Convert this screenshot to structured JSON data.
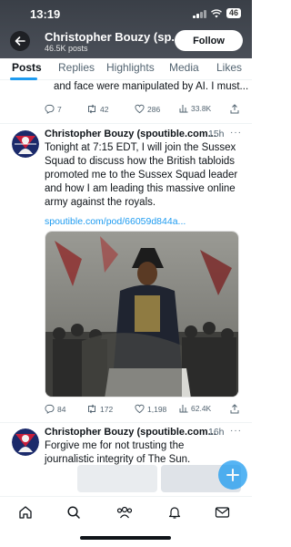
{
  "status_bar": {
    "time": "13:19",
    "battery": "46"
  },
  "header": {
    "name": "Christopher Bouzy (sp...",
    "subtitle": "46.5K posts",
    "follow_label": "Follow"
  },
  "tabs": [
    {
      "label": "Posts",
      "active": true
    },
    {
      "label": "Replies",
      "active": false
    },
    {
      "label": "Highlights",
      "active": false
    },
    {
      "label": "Media",
      "active": false
    },
    {
      "label": "Likes",
      "active": false
    }
  ],
  "post0": {
    "text": "and face were manipulated by AI. I must...",
    "replies": "7",
    "reposts": "42",
    "likes": "286",
    "views": "33.8K"
  },
  "post1": {
    "author": "Christopher Bouzy (spoutible.com...",
    "time": "15h",
    "text": "Tonight at 7:15 EDT, I will join the Sussex Squad to discuss how the British tabloids promoted me to the Sussex Squad leader and how I am leading this massive online army against the royals.",
    "link": "spoutible.com/pod/66059d844a...",
    "replies": "84",
    "reposts": "172",
    "likes": "1,198",
    "views": "62.4K"
  },
  "post2": {
    "author": "Christopher Bouzy (spoutible.com...",
    "time": "16h",
    "text": "Forgive me for not trusting the journalistic integrity of The Sun."
  },
  "colors": {
    "accent": "#1d9bf0",
    "text": "#0f1419",
    "muted": "#536471"
  },
  "icons": [
    "back-arrow-icon",
    "reply-icon",
    "repost-icon",
    "like-icon",
    "views-icon",
    "share-icon",
    "more-icon",
    "home-icon",
    "search-icon",
    "communities-icon",
    "notifications-icon",
    "messages-icon",
    "compose-icon"
  ]
}
